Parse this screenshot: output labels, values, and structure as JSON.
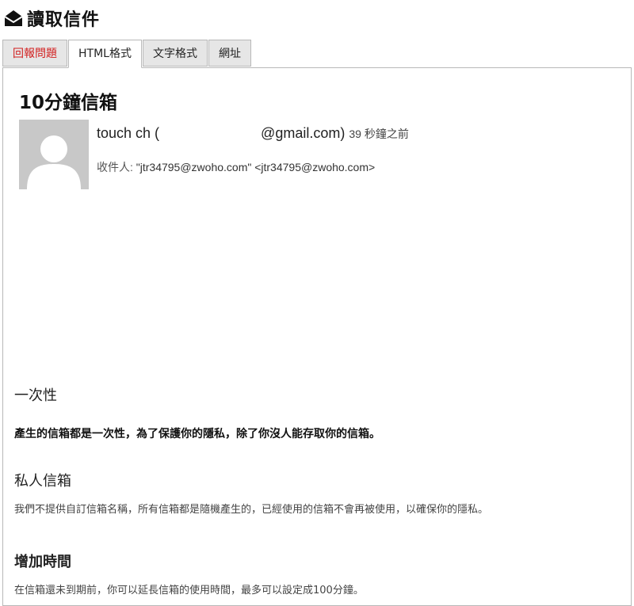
{
  "header": {
    "title": "讀取信件",
    "icon": "envelope-open-icon"
  },
  "tabs": [
    {
      "label": "回報問題",
      "active": false
    },
    {
      "label": "HTML格式",
      "active": true
    },
    {
      "label": "文字格式",
      "active": false
    },
    {
      "label": "網址",
      "active": false
    }
  ],
  "mail": {
    "subject": "10分鐘信箱",
    "from_name": "touch ch (",
    "from_email_suffix": "@gmail.com)",
    "time": "39 秒鐘之前",
    "to_label": "收件人:",
    "to_value": "\"jtr34795@zwoho.com\" <jtr34795@zwoho.com>"
  },
  "content": {
    "sections": [
      {
        "heading": "一次性",
        "text": "產生的信箱都是一次性，為了保護你的隱私，除了你沒人能存取你的信箱。"
      },
      {
        "heading": "私人信箱",
        "text": "我們不提供自訂信箱名稱，所有信箱都是隨機產生的，已經使用的信箱不會再被使用，以確保你的隱私。"
      },
      {
        "heading": "增加時間",
        "text": "在信箱還未到期前，你可以延長信箱的使用時間，最多可以設定成100分鐘。"
      }
    ]
  },
  "colors": {
    "tab_bg": "#e6e6e6",
    "tab_border": "#b8b8b8",
    "report_tab_text": "#d21e1e",
    "avatar_bg": "#c8c8c8"
  }
}
